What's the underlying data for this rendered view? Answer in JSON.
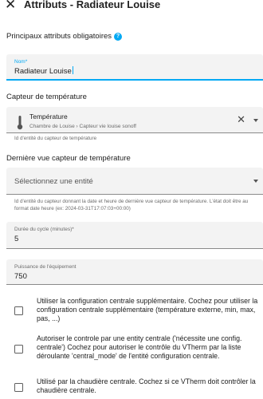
{
  "header": {
    "close_glyph": "✕",
    "title": "Attributs - Radiateur Louise"
  },
  "main_section": {
    "title": "Principaux attributs obligatoires",
    "help_glyph": "?"
  },
  "name_field": {
    "label": "Nom*",
    "value": "Radiateur Louise"
  },
  "sensor_section": {
    "title": "Capteur de température"
  },
  "sensor_field": {
    "entity_name": "Température",
    "entity_path": "Chambre de Louise › Capteur vie louise sonoff",
    "clear_glyph": "✕",
    "helper": "Id d'entité du capteur de température"
  },
  "last_seen_section": {
    "title": "Dernière vue capteur de température"
  },
  "last_seen_field": {
    "placeholder": "Sélectionnez une entité",
    "helper": "Id d'entité du capteur donnant la date et heure de dernière vue capteur de température. L'état doit être au format date heure (ex: 2024-03-31T17:07:03+00:00)"
  },
  "cycle_field": {
    "label": "Durée du cycle (minutes)*",
    "value": "5"
  },
  "power_field": {
    "label": "Puissance de l'équipement",
    "value": "750"
  },
  "options": [
    {
      "text": "Utiliser la configuration centrale supplémentaire. Cochez pour utiliser la configuration centrale supplémentaire (température externe, min, max, pas, ...)",
      "checked": false
    },
    {
      "text": "Autoriser le controle par une entity centrale ('nécessite une config. centrale') Cochez pour autoriser le contrôle du VTherm par la liste déroulante 'central_mode' de l'entité configuration centrale.",
      "checked": false
    },
    {
      "text": "Utilisé par la chaudière centrale. Cochez si ce VTherm doit contrôler la chaudière centrale.",
      "checked": false
    }
  ],
  "colors": {
    "accent": "#03a9f4",
    "field_background": "#f3f3f3",
    "text": "#212121",
    "secondary_text": "#6b6b6b"
  }
}
